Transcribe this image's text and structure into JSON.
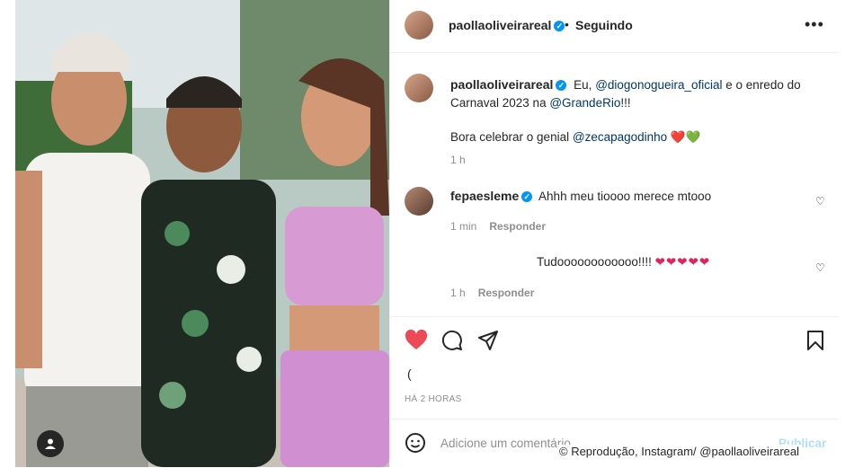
{
  "post": {
    "username": "paollaoliveirareal",
    "separator": "•",
    "follow_status": "Seguindo",
    "more_icon": "more-horizontal-icon"
  },
  "caption": {
    "username": "paollaoliveirareal",
    "text_1": "Eu,",
    "mention_1": "@diogonogueira_oficial",
    "text_2": "e o enredo do Carnaval 2023 na",
    "mention_2": "@GrandeRio",
    "text_3": "!!!",
    "line2_text": "Bora celebrar o genial",
    "mention_3": "@zecapagodinho",
    "emojis": "❤️💚",
    "time": "1 h"
  },
  "comments": [
    {
      "username": "fepaesleme",
      "text": "Ahhh meu tioooo merece mtooo",
      "time": "1 min",
      "reply": "Responder"
    },
    {
      "text": "Tudoooooooooooo!!!!",
      "hearts": "❤❤❤❤❤",
      "time": "1 h",
      "reply": "Responder"
    }
  ],
  "actions": {
    "like_icon": "heart-filled-icon",
    "comment_icon": "comment-icon",
    "share_icon": "share-icon",
    "save_icon": "bookmark-icon",
    "likes_text": "(",
    "time_ago": "HÁ 2 HORAS"
  },
  "add_comment": {
    "placeholder": "Adicione um comentário...",
    "publish": "Publicar"
  },
  "credit": "© Reprodução, Instagram/ @paollaoliveirareal",
  "colors": {
    "like": "#ed4956",
    "link": "#00376b",
    "verified": "#0095f6",
    "publish": "#b2dffc"
  }
}
